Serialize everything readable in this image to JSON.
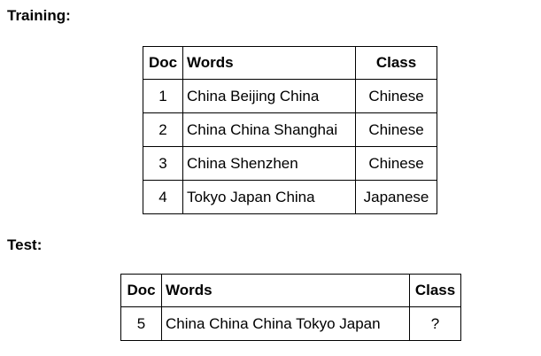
{
  "training": {
    "label": "Training:",
    "headers": {
      "doc": "Doc",
      "words": "Words",
      "class": "Class"
    },
    "rows": [
      {
        "doc": "1",
        "words": "China Beijing China",
        "class": "Chinese"
      },
      {
        "doc": "2",
        "words": "China China Shanghai",
        "class": "Chinese"
      },
      {
        "doc": "3",
        "words": "China Shenzhen",
        "class": "Chinese"
      },
      {
        "doc": "4",
        "words": "Tokyo Japan China",
        "class": "Japanese"
      }
    ]
  },
  "test": {
    "label": "Test:",
    "headers": {
      "doc": "Doc",
      "words": "Words",
      "class": "Class"
    },
    "rows": [
      {
        "doc": "5",
        "words": "China China China Tokyo Japan",
        "class": "?"
      }
    ]
  }
}
